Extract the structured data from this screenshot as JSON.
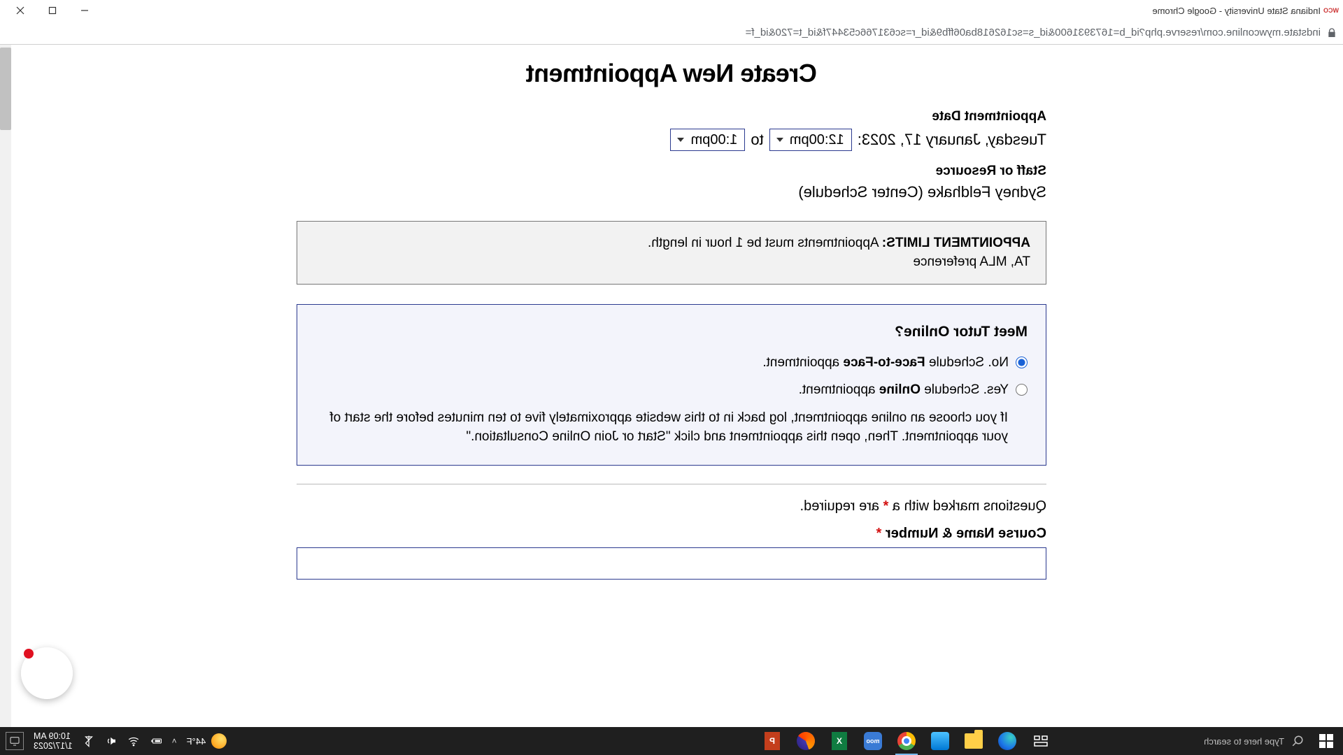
{
  "window": {
    "title": "Indiana State University - Google Chrome",
    "url": "indstate.mywconline.com/reserve.php?id_b=1673931600&id_s=sc162618ba06ffb9&id_r=sc631766c53447f&id_t=720&id_f="
  },
  "page": {
    "heading": "Create New Appointment",
    "appointment_date_label": "Appointment Date",
    "date_text": "Tuesday, January 17, 2023:",
    "time_start": "12:00pm",
    "to_text": "to",
    "time_end": "1:00pm",
    "staff_label": "Staff or Resource",
    "staff_name": "Sydney Feldhake (Center Schedule)",
    "limits_strong": "APPOINTMENT LIMITS:",
    "limits_rest": " Appointments must be 1 hour in length.",
    "limits_line2": "TA, MLA preference",
    "meet_q": "Meet Tutor Online?",
    "opt_no_pre": "No. Schedule ",
    "opt_no_bold": "Face-to-Face",
    "opt_no_post": " appointment.",
    "opt_yes_pre": "Yes. Schedule ",
    "opt_yes_bold": "Online",
    "opt_yes_post": " appointment.",
    "opt_hint": "If you choose an online appointment, log back in to this website approximately five to ten minutes before the start of your appointment. Then, open this appointment and click \"Start or Join Online Consultation.\"",
    "req_pre": "Questions marked with a ",
    "req_star": "*",
    "req_post": " are required.",
    "course_label": "Course Name & Number",
    "course_star": "*"
  },
  "taskbar": {
    "search_placeholder": "Type here to search",
    "moodle": "moo",
    "excel": "X",
    "ppt": "P",
    "temp": "44°F",
    "time": "10:09 AM",
    "date": "1/17/2023"
  }
}
